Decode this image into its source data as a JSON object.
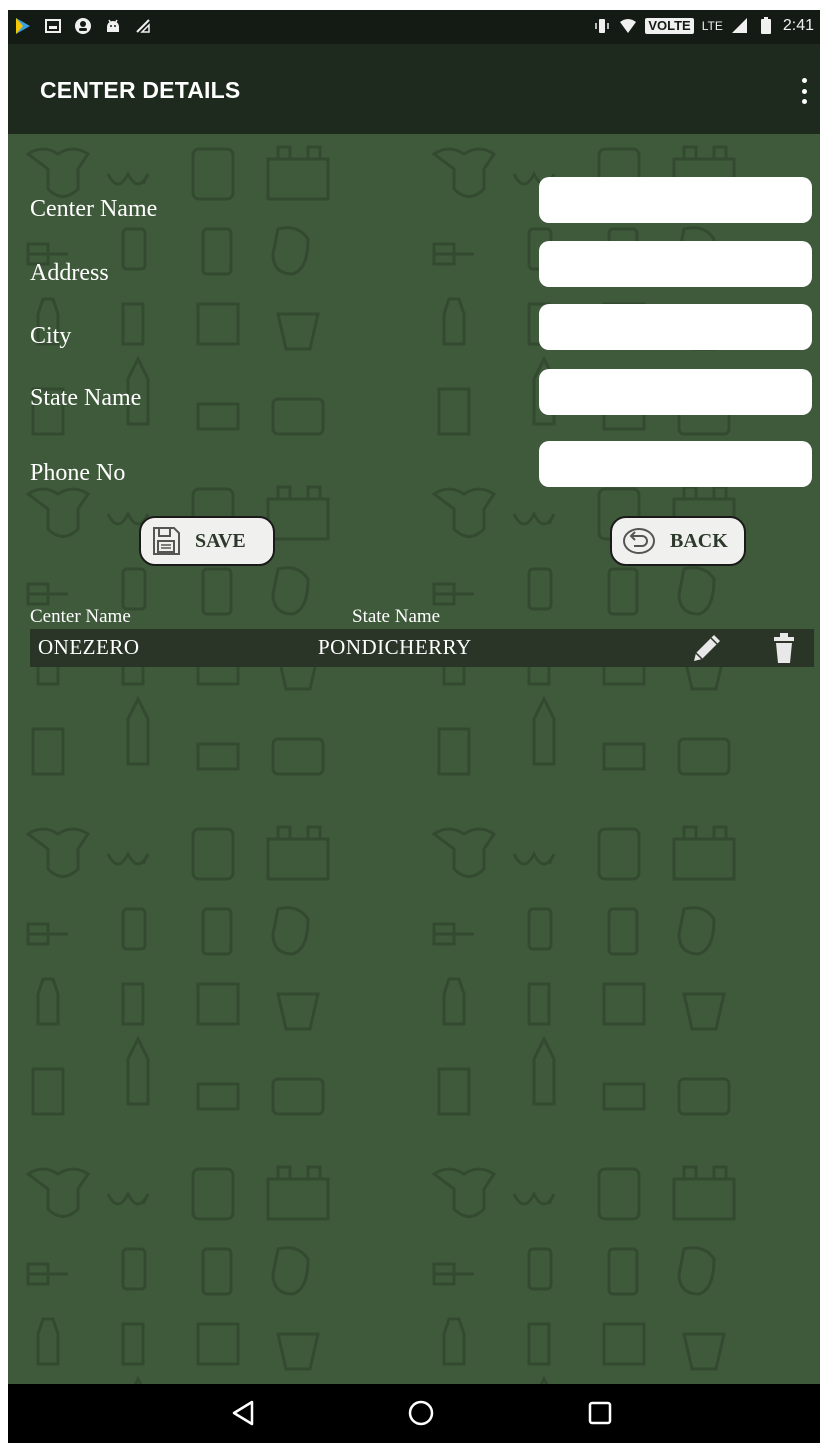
{
  "status_bar": {
    "time": "2:41",
    "network_badge": "VOLTE",
    "network_type": "LTE",
    "left_icons": [
      "play-store-icon",
      "image-icon",
      "account-icon",
      "android-icon",
      "no-signal-icon"
    ],
    "right_icons": [
      "vibrate-icon",
      "wifi-icon",
      "signal-icon",
      "battery-icon"
    ]
  },
  "app_bar": {
    "title": "CENTER DETAILS",
    "menu_icon": "more-vert-icon"
  },
  "form": {
    "center_name_label": "Center Name",
    "center_name_value": "",
    "address_label": "Address",
    "address_value": "",
    "city_label": "City",
    "city_value": "",
    "state_name_label": "State Name",
    "state_name_value": "",
    "phone_label": "Phone No",
    "phone_value": ""
  },
  "buttons": {
    "save_label": "SAVE",
    "save_icon": "floppy-disk-icon",
    "back_label": "BACK",
    "back_icon": "undo-icon"
  },
  "list": {
    "columns": [
      "Center Name",
      "State Name"
    ],
    "rows": [
      {
        "center_name": "ONEZERO",
        "state_name": "PONDICHERRY",
        "edit_icon": "pencil-icon",
        "delete_icon": "trash-icon"
      }
    ]
  },
  "nav_bar": {
    "icons": [
      "back-triangle-icon",
      "home-circle-icon",
      "recents-square-icon"
    ]
  },
  "colors": {
    "background": "#3f5a3b",
    "app_bar": "#1f2a1f",
    "status_bar": "#141a14",
    "row": "#2a3528",
    "button_bg": "#f0f1ee"
  }
}
